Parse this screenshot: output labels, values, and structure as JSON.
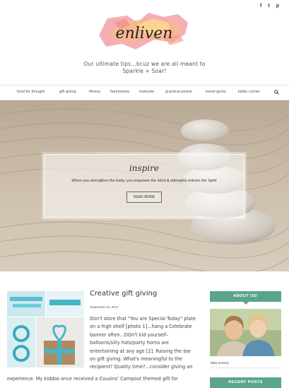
{
  "social": {
    "facebook": "f",
    "twitter": "t",
    "pinterest": "p"
  },
  "logo": {
    "text": "enliven"
  },
  "header": {
    "tagline_line1": "Our ultimate tips...bcuz we are all meant to",
    "tagline_line2": "Sparkle + Soar!"
  },
  "nav": {
    "items": [
      "food for thought",
      "gift giving",
      "fitness",
      "fashionista",
      "motivate",
      "practical pearls",
      "travel gems",
      "kiddo corner"
    ]
  },
  "hero": {
    "title": "inspire",
    "text": "When you strengthen the body, you empower the mind & ultimately enliven the Spirit",
    "button": "READ MORE"
  },
  "post": {
    "title": "Creative gift giving",
    "date": "September 24, 2017",
    "body_lines": [
      "Don't store that \"You are Special Today\" plate",
      "on a high shelf [photo 1]...hang a Celebrate",
      "banner often...DOn't kid yourself–",
      "balloons/silly hats/party horns are",
      "entertaining at any age [2]. Raising the bar",
      "on gift giving. What's meaningful to the",
      "recipient? Quality time?...consider giving an"
    ],
    "body_wide": "experience. My kiddos once received a Cousins' Campout themed gift for"
  },
  "sidebar": {
    "about_title": "ABOUT US!",
    "about_caption": "Eliza & Kerry",
    "recent_title": "RECENT POSTS"
  },
  "colors": {
    "accent": "#5aa58a"
  }
}
